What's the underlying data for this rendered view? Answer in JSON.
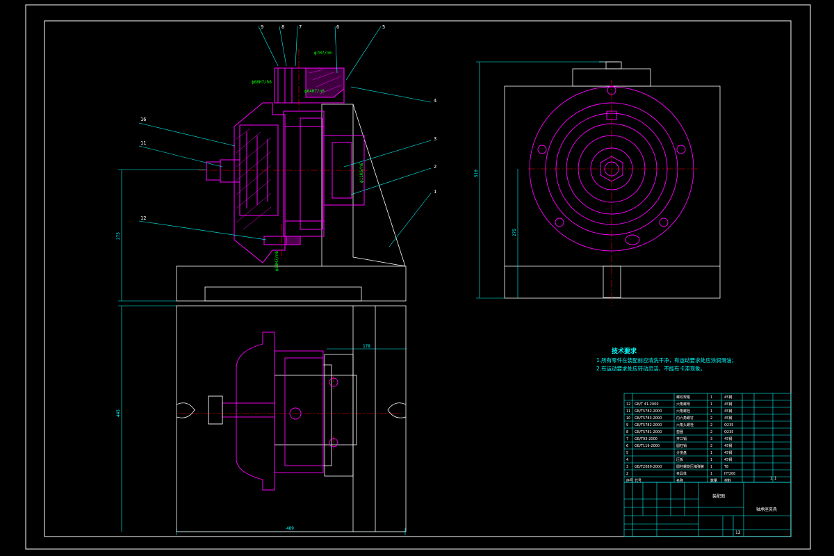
{
  "drawing": {
    "frame": "A2 assembly drawing",
    "colors": {
      "background": "#000000",
      "outline": "#ffffff",
      "part_highlight": "#ff00ff",
      "dimension": "#00ffff",
      "centerline": "#ff0000",
      "fit_text": "#00ff00"
    }
  },
  "balloons": [
    "9",
    "8",
    "7",
    "6",
    "5",
    "4",
    "3",
    "2",
    "1",
    "16",
    "11",
    "12"
  ],
  "dimensions": {
    "height_front": "275",
    "height_side_total": "510",
    "height_side": "275",
    "top_width": "445",
    "bottom_width": "489",
    "offset": "178"
  },
  "fits": [
    "ф7H7/n6",
    "ф68H7/h6",
    "ф84H7/n6",
    "ф11K6/h6",
    "ф10H7/n6"
  ],
  "notes": {
    "title": "技术要求",
    "line1": "1.所有零件在装配前应清洗干净，有运动要求处应涂润滑油；",
    "line2": "2.有运动要求处应转动灵活，不能有卡滞现象。"
  },
  "bom": {
    "rows": [
      {
        "no": "",
        "std": "",
        "name": "螺纹规格",
        "qty": "1",
        "mat": "45钢"
      },
      {
        "no": "12",
        "std": "GB/T 41-2000",
        "name": "六角螺母",
        "qty": "1",
        "mat": "45钢"
      },
      {
        "no": "11",
        "std": "GB/T5782-2000",
        "name": "六角螺栓",
        "qty": "1",
        "mat": "45钢"
      },
      {
        "no": "10",
        "std": "GB/T5783-2000",
        "name": "内六角螺钉",
        "qty": "2",
        "mat": "45钢"
      },
      {
        "no": "9",
        "std": "GB/T5782-2000",
        "name": "六角头螺栓",
        "qty": "2",
        "mat": "Q235"
      },
      {
        "no": "8",
        "std": "GB/T5781-2000",
        "name": "垫圈",
        "qty": "2",
        "mat": "Q235"
      },
      {
        "no": "7",
        "std": "GB/T93-2000",
        "name": "开口销",
        "qty": "3",
        "mat": "45钢"
      },
      {
        "no": "6",
        "std": "GB/T119-2000",
        "name": "圆柱销",
        "qty": "2",
        "mat": "45钢"
      },
      {
        "no": "5",
        "std": "",
        "name": "分度盘",
        "qty": "1",
        "mat": "45钢"
      },
      {
        "no": "4",
        "std": "",
        "name": "压板",
        "qty": "1",
        "mat": "45钢"
      },
      {
        "no": "3",
        "std": "GB/T2089-2000",
        "name": "圆柱螺旋压缩弹簧",
        "qty": "1",
        "mat": "T8"
      },
      {
        "no": "2",
        "std": "",
        "name": "夹具体",
        "qty": "1",
        "mat": "HT200"
      }
    ],
    "header": {
      "no": "序号",
      "std": "代号",
      "name": "名称",
      "qty": "数量",
      "mat": "材料"
    },
    "row_marks": [
      "? ?",
      "? ?",
      "???",
      "? ?",
      "? ?",
      "? ?",
      "? ?",
      "? ?"
    ]
  },
  "title_block": {
    "drawing_type": "装配图",
    "title": "轴承座夹具",
    "scale": "1:2",
    "sheet": "1 1",
    "code": "12"
  }
}
